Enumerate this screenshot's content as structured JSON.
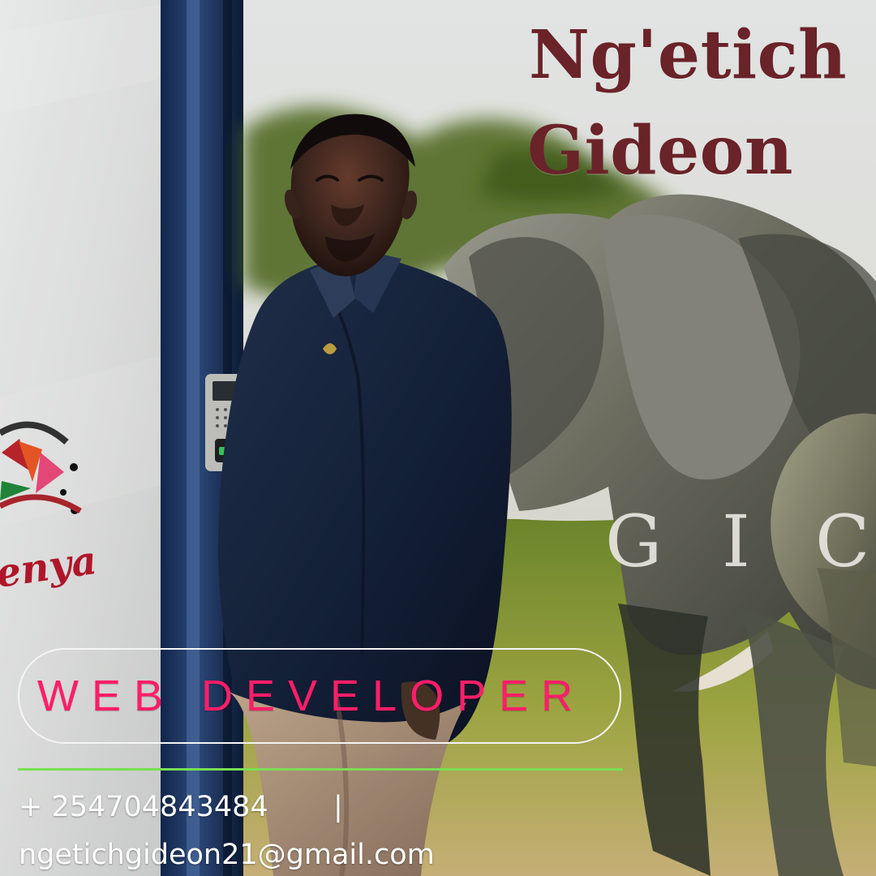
{
  "title": {
    "first_name": "Ng'etich",
    "last_name": "Gideon"
  },
  "scene": {
    "background_letters": [
      "G",
      "I",
      "C"
    ],
    "kenya_logo_text": "enya"
  },
  "role": {
    "label": "WEB DEVELOPER"
  },
  "contact": {
    "phone": "+ 254704843484",
    "separator": "|",
    "email": "ngetichgideon21@gmail.com"
  },
  "colors": {
    "title": "#6a2328",
    "role_text": "#ff1e69",
    "rule": "#78df52",
    "contact_text": "#ffffff"
  },
  "icons": {
    "logo": "kenya-tourism-logo",
    "security_device": "biometric-terminal-icon"
  }
}
